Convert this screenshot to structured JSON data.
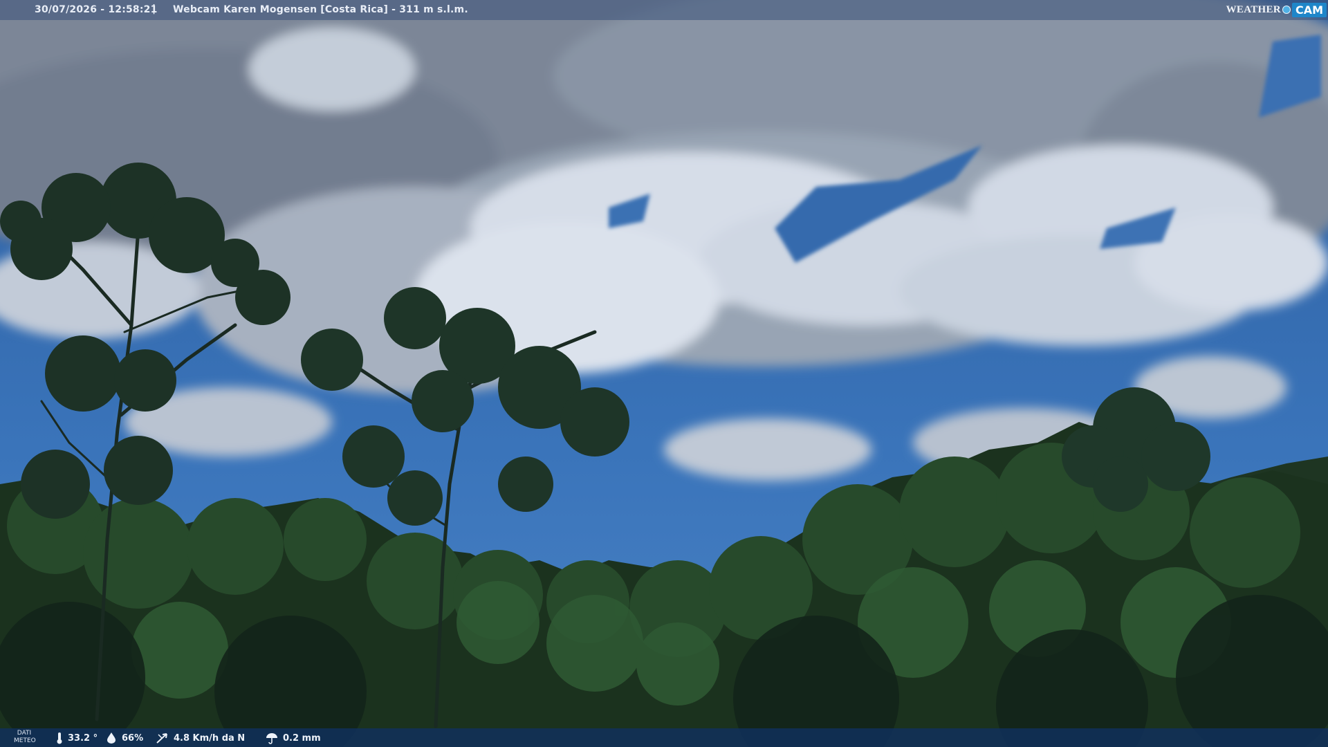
{
  "overlay": {
    "timestamp": "30/07/2026 - 12:58:21",
    "separator": "|",
    "title": "Webcam Karen Mogensen [Costa Rica] - 311 m s.l.m.",
    "logo": {
      "word": "WEATHER",
      "cam": "CAM"
    }
  },
  "weather_bar": {
    "label_line1": "DATI",
    "label_line2": "METEO",
    "temperature": "33.2 °",
    "humidity": "66%",
    "wind": "4.8 Km/h da N",
    "rain": "0.2 mm"
  },
  "colors": {
    "sky_top": "#2f63a6",
    "sky_bottom": "#3f79c0",
    "cloud_light": "#dfe6f0",
    "cloud_gray": "#7f8c9d",
    "forest_dark": "#14281a",
    "forest_mid": "#243f26"
  }
}
